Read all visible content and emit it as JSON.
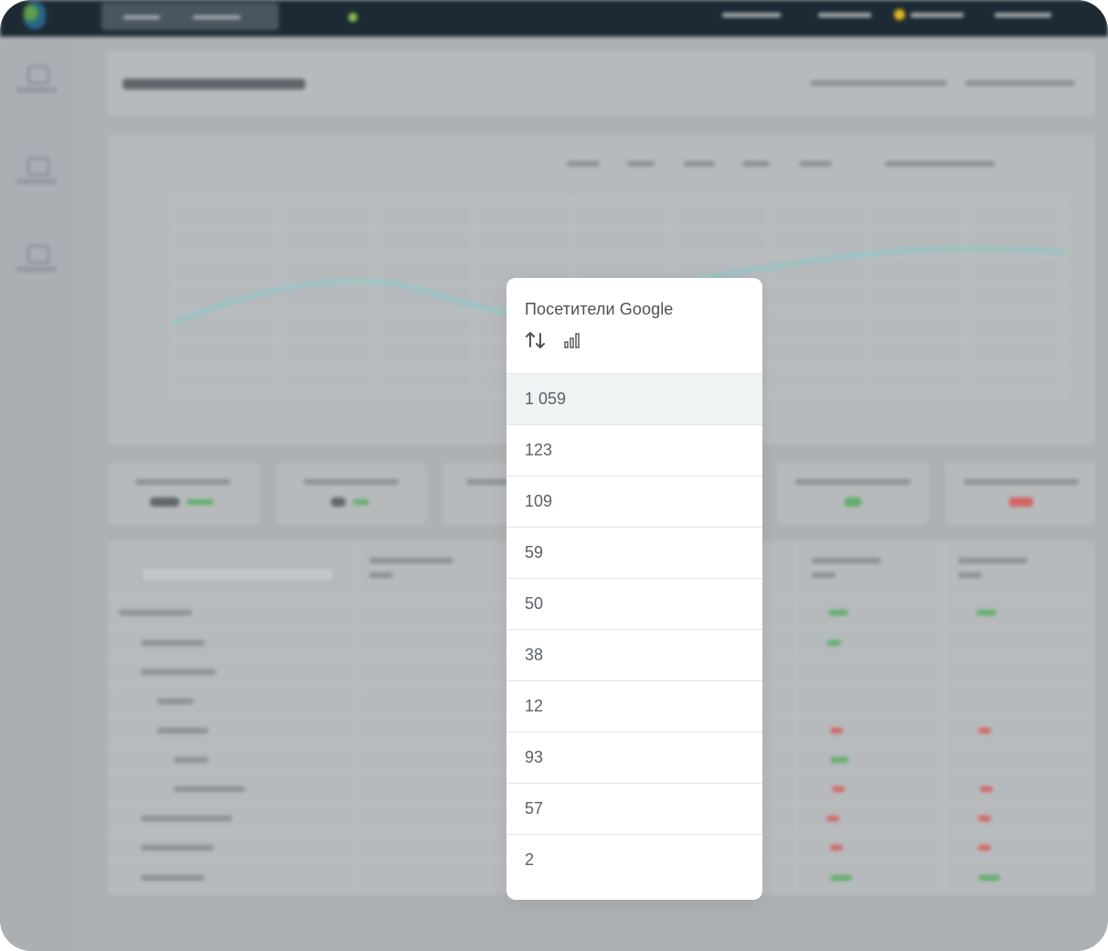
{
  "popover": {
    "title": "Посетители Google",
    "icons": [
      "sort-icon",
      "bar-chart-icon"
    ],
    "values": [
      "1 059",
      "123",
      "109",
      "59",
      "50",
      "38",
      "12",
      "93",
      "57",
      "2"
    ],
    "highlighted_index": 0
  },
  "colors": {
    "topbar": "#1d2a33",
    "popover_bg": "#ffffff",
    "highlight_row": "#eff3f4",
    "text": "#5a6066",
    "overlay": "#aeb1b3"
  }
}
